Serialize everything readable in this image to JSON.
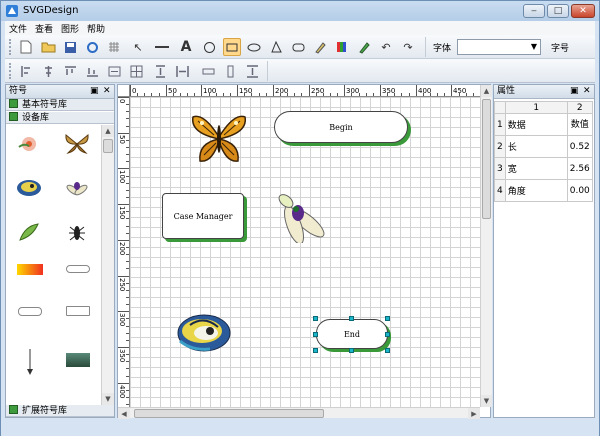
{
  "window": {
    "title": "SVGDesign"
  },
  "menu": [
    "文件",
    "查看",
    "图形",
    "帮助"
  ],
  "toolbar": {
    "font_label": "字体",
    "font_value": "",
    "size_label": "字号"
  },
  "left_panel": {
    "title": "符号",
    "libraries": [
      "基本符号库",
      "设备库"
    ],
    "footer_library": "扩展符号库",
    "symbols": [
      "flower",
      "butterfly",
      "bird",
      "cicada",
      "leaf",
      "insect",
      "gradient-bar",
      "small-button",
      "end-button",
      "case-manager-rect",
      "arrow",
      "gradient-rect"
    ]
  },
  "ruler": {
    "h_ticks": [
      "0",
      "50",
      "100",
      "150",
      "200",
      "250",
      "300",
      "350",
      "400",
      "450"
    ],
    "v_ticks": [
      "0",
      "50",
      "100",
      "150",
      "200",
      "250",
      "300",
      "350",
      "400"
    ]
  },
  "canvas": {
    "shapes": [
      {
        "kind": "butterfly"
      },
      {
        "kind": "button",
        "label": "Begin"
      },
      {
        "kind": "rect",
        "label": "Case Manager"
      },
      {
        "kind": "cicada"
      },
      {
        "kind": "bird"
      },
      {
        "kind": "button",
        "label": "End",
        "selected": true
      }
    ]
  },
  "properties": {
    "title": "属性",
    "col_headers": [
      "1",
      "2"
    ],
    "rows": [
      {
        "idx": "1",
        "name": "数据",
        "value": "数值"
      },
      {
        "idx": "2",
        "name": "长",
        "value": "0.52"
      },
      {
        "idx": "3",
        "name": "宽",
        "value": "2.56"
      },
      {
        "idx": "4",
        "name": "角度",
        "value": "0.00"
      }
    ]
  }
}
